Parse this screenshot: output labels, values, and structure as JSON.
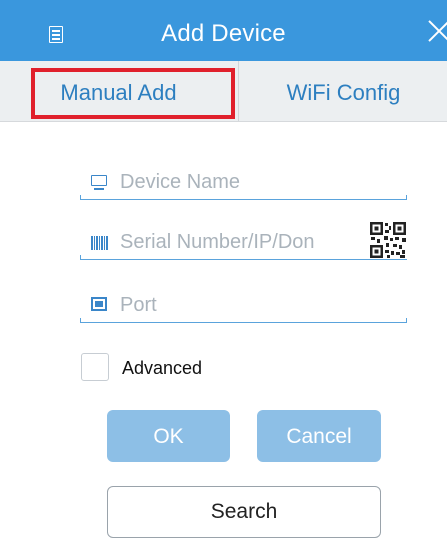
{
  "header": {
    "title": "Add Device",
    "menu_icon": "menu-icon",
    "close_icon": "close-icon",
    "background_color": "#3a97dd"
  },
  "tabs": [
    {
      "label": "Manual Add",
      "selected": true
    },
    {
      "label": "WiFi Config",
      "selected": false
    }
  ],
  "form": {
    "device_name": {
      "placeholder": "Device Name",
      "value": "",
      "icon": "monitor-icon"
    },
    "serial": {
      "placeholder": "Serial Number/IP/Don",
      "value": "",
      "icon": "barcode-icon",
      "scan_icon": "qr-code-icon"
    },
    "port": {
      "placeholder": "Port",
      "value": "",
      "icon": "port-icon"
    },
    "advanced": {
      "label": "Advanced",
      "checked": false
    }
  },
  "actions": {
    "ok_label": "OK",
    "cancel_label": "Cancel",
    "search_label": "Search"
  },
  "colors": {
    "accent": "#3a97dd",
    "highlight_border": "#e0202c",
    "button_fill": "#8dbfe6",
    "tab_text": "#2d7fc0"
  }
}
